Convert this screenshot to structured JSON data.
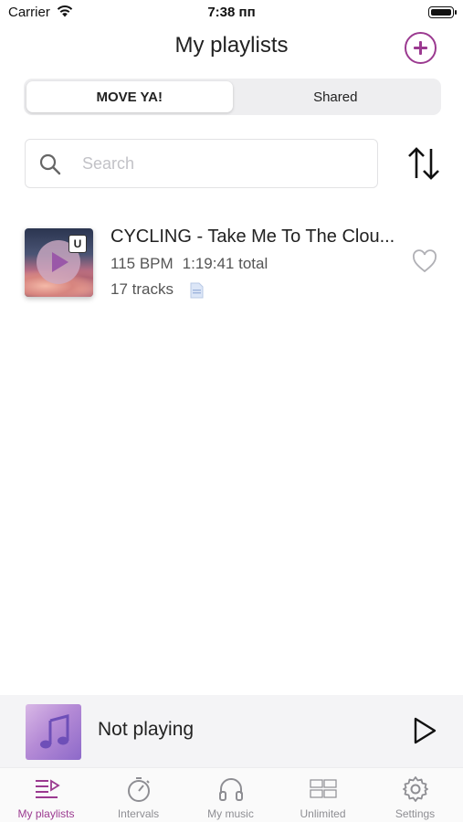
{
  "status_bar": {
    "carrier": "Carrier",
    "time": "7:38 пп"
  },
  "header": {
    "title": "My playlists",
    "add_icon": "plus-circle-icon"
  },
  "segments": [
    {
      "label": "MOVE YA!",
      "active": true
    },
    {
      "label": "Shared",
      "active": false
    }
  ],
  "search": {
    "placeholder": "Search"
  },
  "playlists": [
    {
      "title": "CYCLING - Take Me To The Clou...",
      "bpm": "115 BPM",
      "duration": "1:19:41 total",
      "tracks": "17 tracks",
      "badge": "U",
      "favorite": false
    }
  ],
  "now_playing": {
    "text": "Not playing"
  },
  "tabs": [
    {
      "label": "My playlists",
      "icon": "playlist-icon",
      "active": true
    },
    {
      "label": "Intervals",
      "icon": "stopwatch-icon",
      "active": false
    },
    {
      "label": "My music",
      "icon": "headphones-icon",
      "active": false
    },
    {
      "label": "Unlimited",
      "icon": "unlimited-icon",
      "active": false
    },
    {
      "label": "Settings",
      "icon": "gear-icon",
      "active": false
    }
  ],
  "colors": {
    "accent": "#9b3a90",
    "inactive": "#8e8e93"
  }
}
